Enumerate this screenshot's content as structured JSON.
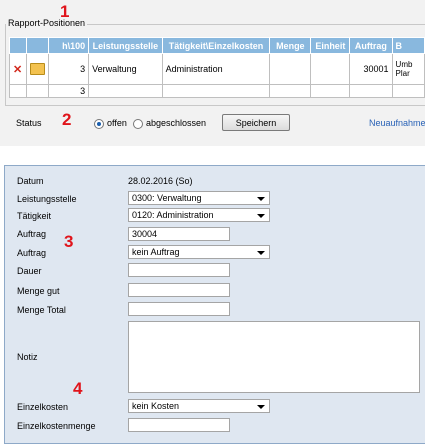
{
  "markers": [
    "1",
    "2",
    "3",
    "4"
  ],
  "positions": {
    "legend": "Rapport-Positionen",
    "columns": [
      "",
      "",
      "h\\100",
      "Leistungsstelle",
      "Tätigkeit\\Einzelkosten",
      "Menge",
      "Einheit",
      "Auftrag",
      "B"
    ],
    "rows": [
      {
        "hours": "3",
        "leistungsstelle": "Verwaltung",
        "taetigkeit": "Administration",
        "menge": "",
        "einheit": "",
        "auftrag": "30001",
        "b": "Umb Plar"
      }
    ],
    "total_hours": "3",
    "icons": {
      "delete": "delete-x-icon",
      "open": "folder-open-icon"
    }
  },
  "status": {
    "label": "Status",
    "options": [
      "offen",
      "abgeschlossen"
    ],
    "selected": "offen",
    "save_label": "Speichern",
    "new_link": "Neuaufnahme"
  },
  "form": {
    "datum_label": "Datum",
    "datum_value": "28.02.2016 (So)",
    "leistungsstelle_label": "Leistungsstelle",
    "leistungsstelle_value": "0300: Verwaltung",
    "taetigkeit_label": "Tätigkeit",
    "taetigkeit_value": "0120: Administration",
    "auftrag_label": "Auftrag",
    "auftrag_value": "30004",
    "auftrag2_label": "Auftrag",
    "auftrag2_value": "kein Auftrag",
    "dauer_label": "Dauer",
    "menge_gut_label": "Menge gut",
    "menge_total_label": "Menge Total",
    "notiz_label": "Notiz",
    "einzelkosten_label": "Einzelkosten",
    "einzelkosten_value": "kein Kosten",
    "einzelkostenmenge_label": "Einzelkostenmenge"
  },
  "colors": {
    "header": "#89b8de",
    "panel": "#dfe7f1",
    "marker": "#e0141b",
    "link": "#2a63b7"
  }
}
